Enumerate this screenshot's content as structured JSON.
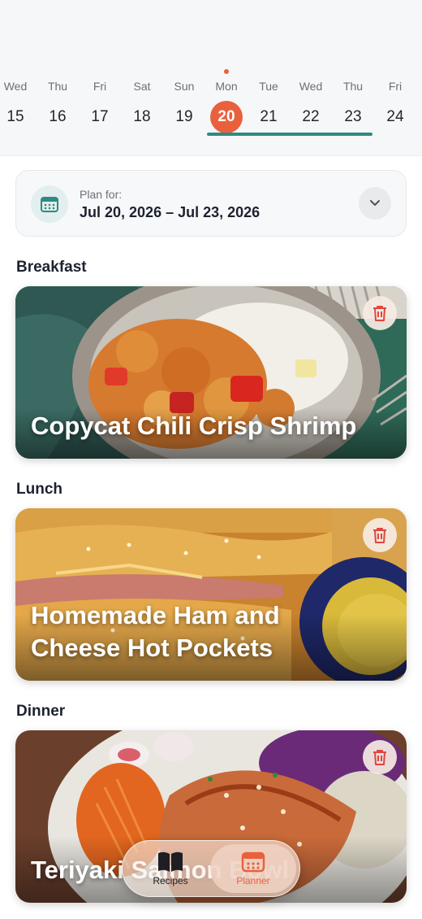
{
  "week": {
    "days": [
      {
        "name": "Wed",
        "num": "15"
      },
      {
        "name": "Thu",
        "num": "16"
      },
      {
        "name": "Fri",
        "num": "17"
      },
      {
        "name": "Sat",
        "num": "18"
      },
      {
        "name": "Sun",
        "num": "19"
      },
      {
        "name": "Mon",
        "num": "20"
      },
      {
        "name": "Tue",
        "num": "21"
      },
      {
        "name": "Wed",
        "num": "22"
      },
      {
        "name": "Thu",
        "num": "23"
      },
      {
        "name": "Fri",
        "num": "24"
      }
    ],
    "selected_index": 5,
    "range_start_index": 5,
    "range_end_index": 8
  },
  "plan": {
    "label": "Plan for:",
    "range": "Jul 20, 2026 – Jul 23, 2026",
    "icon": "calendar-icon",
    "expand_icon": "chevron-down-icon"
  },
  "meals": [
    {
      "label": "Breakfast",
      "title": "Copycat Chili Crisp Shrimp",
      "delete_icon": "trash-icon"
    },
    {
      "label": "Lunch",
      "title": "Homemade Ham and Cheese Hot Pockets",
      "delete_icon": "trash-icon"
    },
    {
      "label": "Dinner",
      "title": "Teriyaki Salmon Bowl",
      "delete_icon": "trash-icon"
    }
  ],
  "tabs": [
    {
      "label": "Recipes",
      "icon": "book-icon",
      "active": false
    },
    {
      "label": "Planner",
      "icon": "calendar-icon",
      "active": true
    }
  ],
  "colors": {
    "accent": "#e8613c",
    "range": "#2f8a82",
    "trash": "#e0463d"
  }
}
